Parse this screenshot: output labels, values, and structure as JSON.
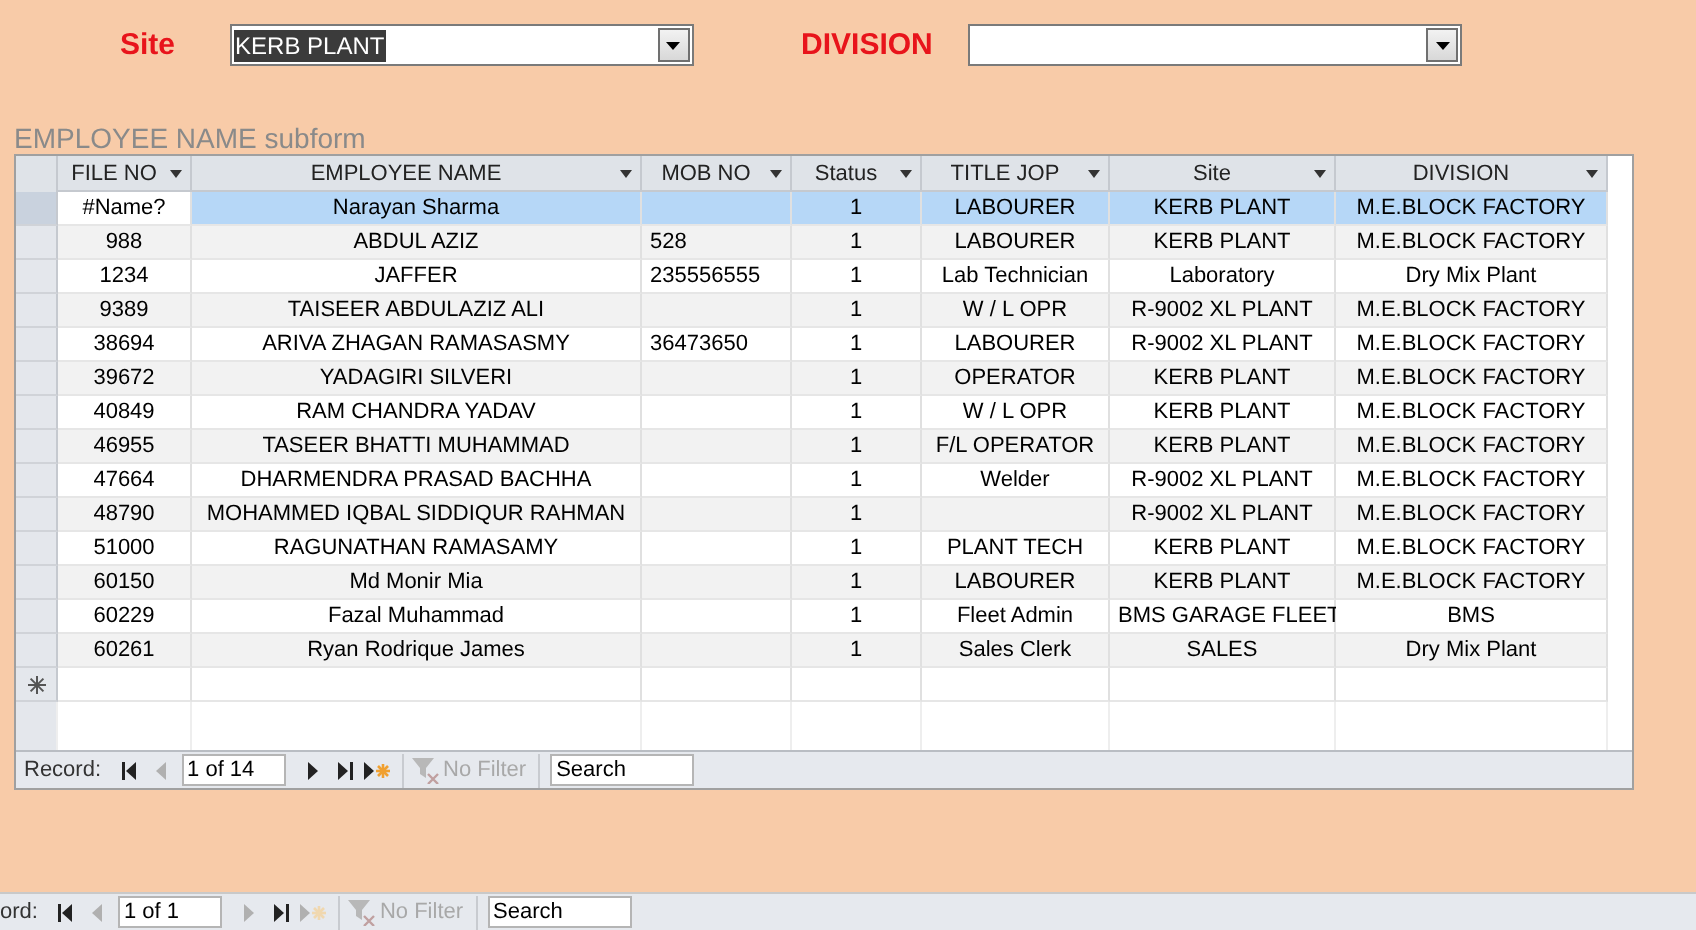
{
  "filters": [
    {
      "label": "Site",
      "value": "KERB PLANT",
      "text_selected": true
    },
    {
      "label": "DIVISION"
    }
  ],
  "subform": {
    "title": "EMPLOYEE  NAME  subform",
    "columns": [
      "FILE NO",
      "EMPLOYEE NAME",
      "MOB NO",
      "Status",
      "TITLE JOP",
      "Site",
      "DIVISION"
    ],
    "rows": [
      {
        "cells": [
          "#Name?",
          "Narayan Sharma",
          "",
          "1",
          "LABOURER",
          "KERB PLANT",
          "M.E.BLOCK FACTORY"
        ],
        "selected": true
      },
      {
        "cells": [
          "988",
          "ABDUL AZIZ",
          "528",
          "1",
          "LABOURER",
          "KERB PLANT",
          "M.E.BLOCK FACTORY"
        ],
        "selected": false
      },
      {
        "cells": [
          "1234",
          "JAFFER",
          "235556555",
          "1",
          "Lab Technician",
          "Laboratory",
          "Dry Mix Plant"
        ],
        "selected": false
      },
      {
        "cells": [
          "9389",
          "TAISEER ABDULAZIZ ALI",
          "",
          "1",
          "W / L OPR",
          "R-9002 XL PLANT",
          "M.E.BLOCK FACTORY"
        ],
        "selected": false
      },
      {
        "cells": [
          "38694",
          "ARIVA ZHAGAN RAMASASMY",
          "36473650",
          "1",
          "LABOURER",
          "R-9002 XL PLANT",
          "M.E.BLOCK FACTORY"
        ],
        "selected": false
      },
      {
        "cells": [
          "39672",
          "YADAGIRI SILVERI",
          "",
          "1",
          "OPERATOR",
          "KERB PLANT",
          "M.E.BLOCK FACTORY"
        ],
        "selected": false
      },
      {
        "cells": [
          "40849",
          "RAM CHANDRA YADAV",
          "",
          "1",
          "W / L OPR",
          "KERB PLANT",
          "M.E.BLOCK FACTORY"
        ],
        "selected": false
      },
      {
        "cells": [
          "46955",
          "TASEER BHATTI MUHAMMAD",
          "",
          "1",
          "F/L OPERATOR",
          "KERB PLANT",
          "M.E.BLOCK FACTORY"
        ],
        "selected": false
      },
      {
        "cells": [
          "47664",
          "DHARMENDRA PRASAD BACHHA",
          "",
          "1",
          "Welder",
          "R-9002 XL PLANT",
          "M.E.BLOCK FACTORY"
        ],
        "selected": false
      },
      {
        "cells": [
          "48790",
          "MOHAMMED IQBAL SIDDIQUR RAHMAN",
          "",
          "1",
          "",
          "R-9002 XL PLANT",
          "M.E.BLOCK FACTORY"
        ],
        "selected": false
      },
      {
        "cells": [
          "51000",
          "RAGUNATHAN RAMASAMY",
          "",
          "1",
          "PLANT TECH",
          "KERB PLANT",
          "M.E.BLOCK FACTORY"
        ],
        "selected": false
      },
      {
        "cells": [
          "60150",
          "Md Monir Mia",
          "",
          "1",
          "LABOURER",
          "KERB PLANT",
          "M.E.BLOCK FACTORY"
        ],
        "selected": false
      },
      {
        "cells": [
          "60229",
          "Fazal Muhammad",
          "",
          "1",
          "Fleet Admin",
          "BMS GARAGE FLEET",
          "BMS"
        ],
        "selected": false
      },
      {
        "cells": [
          "60261",
          "Ryan Rodrique James",
          "",
          "1",
          "Sales Clerk",
          "SALES",
          "Dry Mix Plant"
        ],
        "selected": false
      }
    ],
    "navigation": {
      "label": "Record:",
      "position": "1 of 14",
      "buttons": [
        {
          "kind": "first",
          "disabled": false
        },
        {
          "kind": "previous",
          "disabled": true
        },
        {
          "kind": "next",
          "disabled": false
        },
        {
          "kind": "last",
          "disabled": false
        },
        {
          "kind": "new",
          "disabled": false
        }
      ],
      "filter": {
        "label": "No Filter",
        "disabled": true
      },
      "search": {
        "placeholder": "Search"
      }
    }
  },
  "form_navigation": {
    "label": "ord:",
    "position": "1 of 1",
    "buttons": [
      {
        "kind": "first",
        "disabled": false
      },
      {
        "kind": "previous",
        "disabled": true
      },
      {
        "kind": "next",
        "disabled": true
      },
      {
        "kind": "last",
        "disabled": false
      },
      {
        "kind": "new",
        "disabled": true
      }
    ],
    "filter": {
      "label": "No Filter",
      "disabled": true
    },
    "search": {
      "placeholder": "Search"
    }
  }
}
